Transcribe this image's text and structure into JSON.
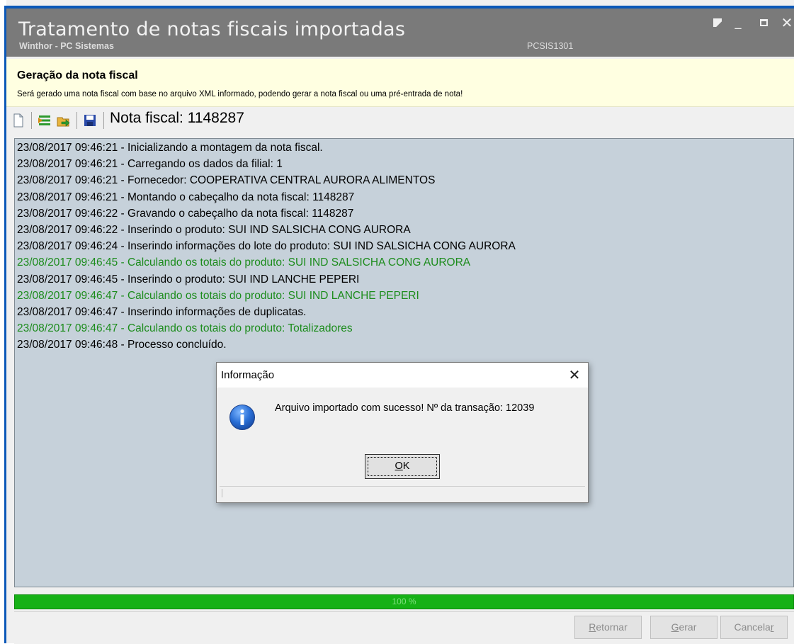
{
  "window": {
    "title": "Tratamento de notas fiscais importadas",
    "subtitle": "Winthor - PC Sistemas",
    "code": "PCSIS1301"
  },
  "banner": {
    "title": "Geração da nota fiscal",
    "description": "Será gerado uma nota fiscal com base no arquivo XML informado, podendo gerar a nota fiscal ou uma pré-entrada de nota!"
  },
  "toolbar": {
    "label": "Nota fiscal: 1148287"
  },
  "colors": {
    "normal_text": "#000000",
    "calc_text": "#1c8c1c",
    "progress": "#16b116",
    "title_bar": "#7a7a7a",
    "banner_bg": "#ffffe1"
  },
  "log": [
    {
      "text": "23/08/2017 09:46:21 - Inicializando a montagem da nota fiscal.",
      "type": "normal"
    },
    {
      "text": "23/08/2017 09:46:21 - Carregando os dados da filial: 1",
      "type": "normal"
    },
    {
      "text": "23/08/2017 09:46:21 - Fornecedor: COOPERATIVA CENTRAL AURORA ALIMENTOS",
      "type": "normal"
    },
    {
      "text": "23/08/2017 09:46:21 - Montando o cabeçalho da nota fiscal: 1148287",
      "type": "normal"
    },
    {
      "text": "23/08/2017 09:46:22 - Gravando o cabeçalho da nota fiscal: 1148287",
      "type": "normal"
    },
    {
      "text": "23/08/2017 09:46:22 - Inserindo o produto: SUI IND SALSICHA CONG AURORA",
      "type": "normal"
    },
    {
      "text": "23/08/2017 09:46:24 - Inserindo informações do lote do produto: SUI IND SALSICHA CONG AURORA",
      "type": "normal"
    },
    {
      "text": "23/08/2017 09:46:45 - Calculando os totais do produto: SUI IND SALSICHA CONG AURORA",
      "type": "calc"
    },
    {
      "text": "23/08/2017 09:46:45 - Inserindo o produto: SUI IND LANCHE PEPERI",
      "type": "normal"
    },
    {
      "text": "23/08/2017 09:46:47 - Calculando os totais do produto: SUI IND LANCHE PEPERI",
      "type": "calc"
    },
    {
      "text": "23/08/2017 09:46:47 - Inserindo informações de duplicatas.",
      "type": "normal"
    },
    {
      "text": "23/08/2017 09:46:47 - Calculando os totais do produto: Totalizadores",
      "type": "calc"
    },
    {
      "text": "23/08/2017 09:46:48 - Processo concluído.",
      "type": "normal"
    }
  ],
  "progress": {
    "percent": 100,
    "label": "100 %"
  },
  "footer": {
    "retornar_prefix": "R",
    "retornar_rest": "etornar",
    "gerar_prefix": "G",
    "gerar_rest": "erar",
    "cancelar_prefix": "Cancela",
    "cancelar_rest": "r"
  },
  "dialog": {
    "title": "Informação",
    "message": "Arquivo importado com sucesso! Nº da transação: 12039",
    "ok_underlined": "O",
    "ok_rest": "K",
    "icon": "info-icon"
  }
}
